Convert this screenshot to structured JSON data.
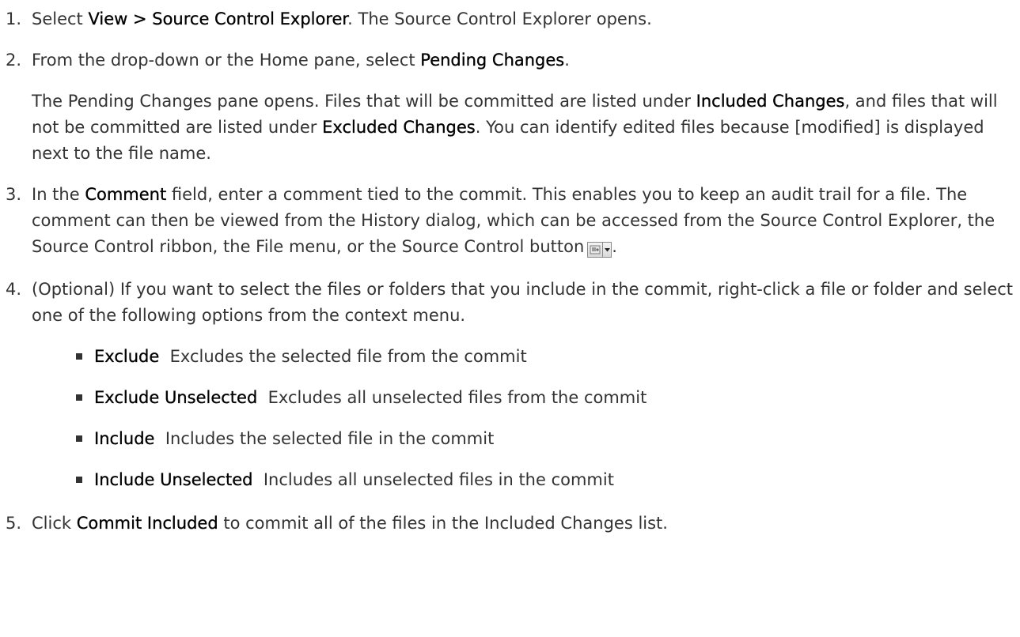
{
  "steps": [
    {
      "num": "1.",
      "parts": {
        "a": "Select ",
        "b": "View > Source Control Explorer",
        "c": ". The Source Control Explorer opens."
      }
    },
    {
      "num": "2.",
      "parts": {
        "a": "From the drop-down or the Home pane, select ",
        "b": "Pending Changes",
        "c": "."
      },
      "para2": {
        "a": "The Pending Changes pane opens. Files that will be committed are listed under ",
        "b": "Included Changes",
        "c": ", and files that will not be committed are listed under ",
        "d": "Excluded Changes",
        "e": ". You can identify edited files because [modified] is displayed next to the file name."
      }
    },
    {
      "num": "3.",
      "parts": {
        "a": "In the ",
        "b": "Comment",
        "c": " field, enter a comment tied to the commit. This enables you to keep an audit trail for a file. The comment can then be viewed from the History dialog, which can be accessed from the Source Control Explorer, the Source Control ribbon, the File menu, or the Source Control button",
        "d": "."
      }
    },
    {
      "num": "4.",
      "parts": {
        "a": "(Optional) If you want to select the files or folders that you include in the commit, right-click a file or folder and select one of the following options from the context menu."
      },
      "options": [
        {
          "term": "Exclude",
          "desc": "Excludes the selected file from the commit"
        },
        {
          "term": "Exclude Unselected",
          "desc": "Excludes all unselected files from the commit"
        },
        {
          "term": "Include",
          "desc": "Includes the selected file in the commit"
        },
        {
          "term": "Include Unselected",
          "desc": "Includes all unselected files in the commit"
        }
      ]
    },
    {
      "num": "5.",
      "parts": {
        "a": "Click ",
        "b": "Commit Included",
        "c": " to commit all of the files in the Included Changes list."
      }
    }
  ],
  "icons": {
    "source_control_button": "source-control-icon",
    "dropdown": "dropdown-arrow-icon"
  },
  "colors": {
    "text": "#333333",
    "bold": "#000000"
  }
}
